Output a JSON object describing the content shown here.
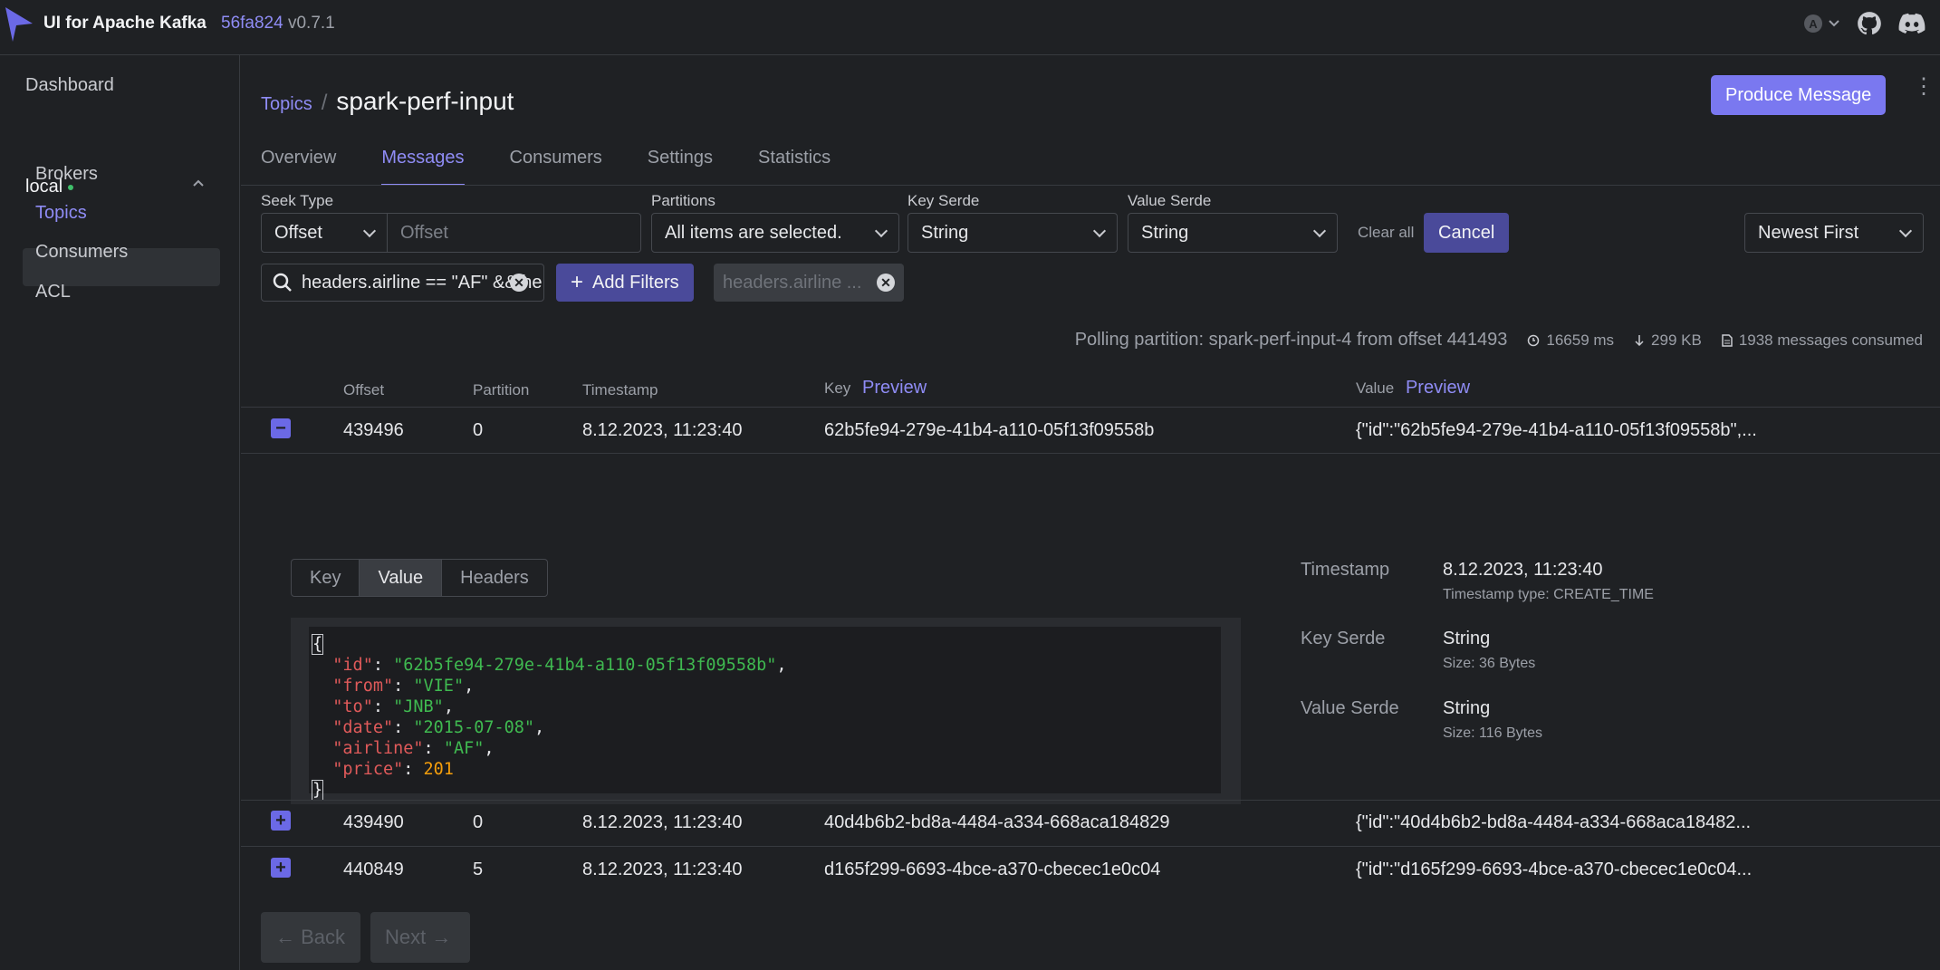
{
  "app": {
    "title": "UI for Apache Kafka",
    "commit": "56fa824",
    "version": "v0.7.1",
    "avatar_letter": "A"
  },
  "sidebar": {
    "dashboard": "Dashboard",
    "cluster": "local",
    "items": [
      {
        "label": "Brokers"
      },
      {
        "label": "Topics"
      },
      {
        "label": "Consumers"
      },
      {
        "label": "ACL"
      }
    ]
  },
  "breadcrumb": {
    "parent": "Topics",
    "sep": "/",
    "current": "spark-perf-input"
  },
  "produce_label": "Produce Message",
  "tabs": [
    "Overview",
    "Messages",
    "Consumers",
    "Settings",
    "Statistics"
  ],
  "filters": {
    "seek_type_label": "Seek Type",
    "seek_type_value": "Offset",
    "offset_placeholder": "Offset",
    "partitions_label": "Partitions",
    "partitions_value": "All items are selected.",
    "key_serde_label": "Key Serde",
    "key_serde_value": "String",
    "value_serde_label": "Value Serde",
    "value_serde_value": "String",
    "clear_all": "Clear all",
    "cancel": "Cancel",
    "sort": "Newest First",
    "search_value": "headers.airline == \"AF\" && he",
    "add_filters": "Add Filters",
    "chip": "headers.airline ..."
  },
  "stats": {
    "polling": "Polling partition: spark-perf-input-4 from offset 441493",
    "elapsed": "16659 ms",
    "bytes": "299 KB",
    "consumed": "1938 messages consumed"
  },
  "table": {
    "headers": {
      "offset": "Offset",
      "partition": "Partition",
      "timestamp": "Timestamp",
      "key": "Key",
      "value": "Value",
      "preview": "Preview"
    },
    "rows": [
      {
        "offset": "439496",
        "partition": "0",
        "timestamp": "8.12.2023, 11:23:40",
        "key": "62b5fe94-279e-41b4-a110-05f13f09558b",
        "value": "{\"id\":\"62b5fe94-279e-41b4-a110-05f13f09558b\",..."
      },
      {
        "offset": "439490",
        "partition": "0",
        "timestamp": "8.12.2023, 11:23:40",
        "key": "40d4b6b2-bd8a-4484-a334-668aca184829",
        "value": "{\"id\":\"40d4b6b2-bd8a-4484-a334-668aca18482..."
      },
      {
        "offset": "440849",
        "partition": "5",
        "timestamp": "8.12.2023, 11:23:40",
        "key": "d165f299-6693-4bce-a370-cbecec1e0c04",
        "value": "{\"id\":\"d165f299-6693-4bce-a370-cbecec1e0c04..."
      }
    ]
  },
  "detail": {
    "tabs": [
      "Key",
      "Value",
      "Headers"
    ],
    "json": {
      "id": "\"62b5fe94-279e-41b4-a110-05f13f09558b\"",
      "from": "\"VIE\"",
      "to": "\"JNB\"",
      "date": "\"2015-07-08\"",
      "airline": "\"AF\"",
      "price": "201"
    },
    "timestamp_label": "Timestamp",
    "timestamp_value": "8.12.2023, 11:23:40",
    "timestamp_type": "Timestamp type: CREATE_TIME",
    "key_serde_label": "Key Serde",
    "key_serde_value": "String",
    "key_size": "Size: 36 Bytes",
    "value_serde_label": "Value Serde",
    "value_serde_value": "String",
    "value_size": "Size: 116 Bytes"
  },
  "pager": {
    "back": "← Back",
    "next": "Next →"
  }
}
